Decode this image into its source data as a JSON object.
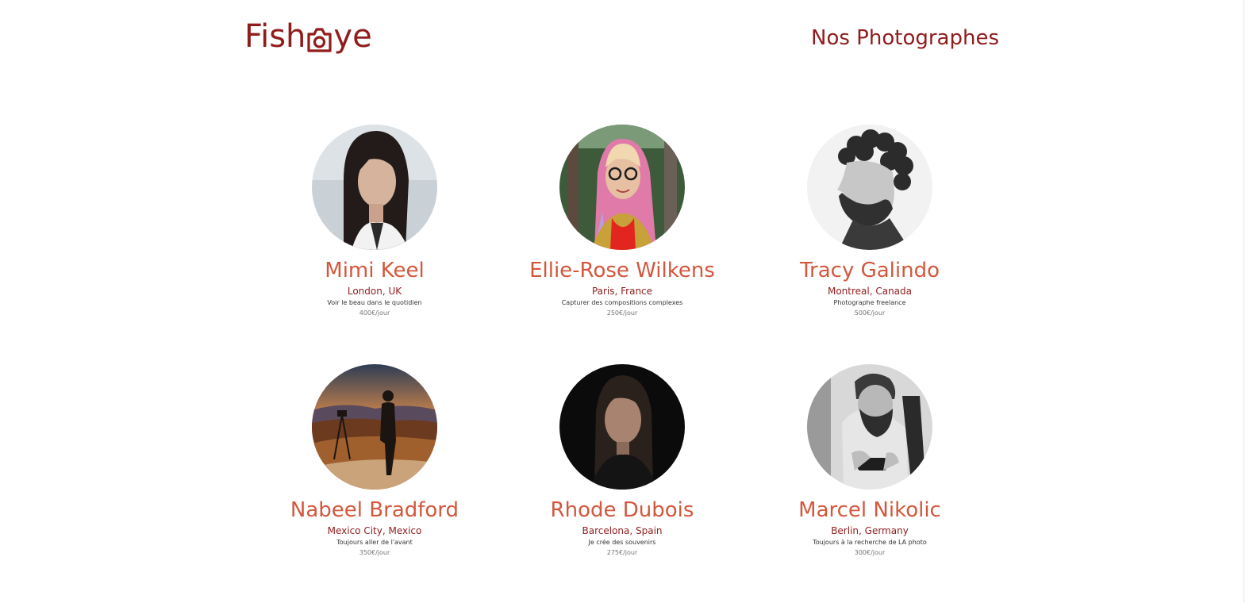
{
  "header": {
    "logo": {
      "text_before": "Fish",
      "text_after": "ye",
      "icon": "camera-icon",
      "color": "#901c1c"
    },
    "title": "Nos Photographes"
  },
  "photographers": [
    {
      "name": "Mimi Keel",
      "location": "London, UK",
      "tagline": "Voir le beau dans le quotidien",
      "price": "400€/jour",
      "portrait": "portrait-woman-dark-hair"
    },
    {
      "name": "Ellie-Rose Wilkens",
      "location": "Paris, France",
      "tagline": "Capturer des compositions complexes",
      "price": "250€/jour",
      "portrait": "portrait-woman-pink-hair-glasses"
    },
    {
      "name": "Tracy Galindo",
      "location": "Montreal, Canada",
      "tagline": "Photographe freelance",
      "price": "500€/jour",
      "portrait": "portrait-bearded-man-curly-hair"
    },
    {
      "name": "Nabeel Bradford",
      "location": "Mexico City, Mexico",
      "tagline": "Toujours aller de l'avant",
      "price": "350€/jour",
      "portrait": "photographer-sunset-silhouette"
    },
    {
      "name": "Rhode Dubois",
      "location": "Barcelona, Spain",
      "tagline": "Je crée des souvenirs",
      "price": "275€/jour",
      "portrait": "portrait-woman-dark-background"
    },
    {
      "name": "Marcel Nikolic",
      "location": "Berlin, Germany",
      "tagline": "Toujours à la recherche de LA photo",
      "price": "300€/jour",
      "portrait": "portrait-bearded-man-with-camera"
    }
  ],
  "colors": {
    "brand": "#901c1c",
    "name": "#d3573c",
    "tagline": "#333333",
    "price": "#757575"
  }
}
